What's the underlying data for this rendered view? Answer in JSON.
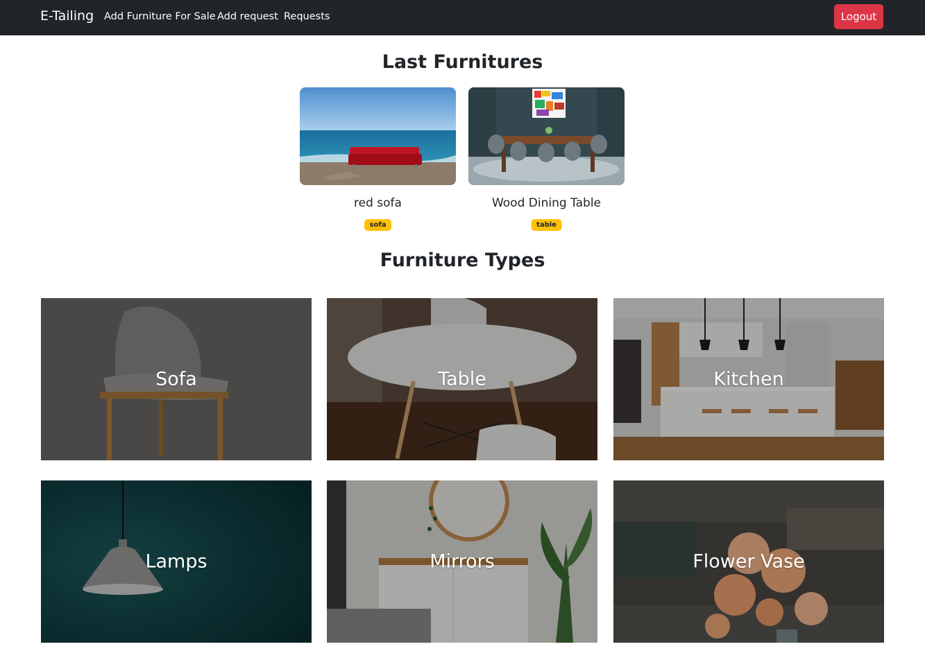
{
  "navbar": {
    "brand": "E-Tailing",
    "links": [
      "Add Furniture For Sale",
      "Add request",
      "Requests"
    ],
    "logout_label": "Logout"
  },
  "last_furnitures": {
    "title": "Last Furnitures",
    "items": [
      {
        "name": "red sofa",
        "badge": "sofa"
      },
      {
        "name": "Wood Dining Table",
        "badge": "table"
      }
    ]
  },
  "furniture_types": {
    "title": "Furniture Types",
    "items": [
      {
        "label": "Sofa"
      },
      {
        "label": "Table"
      },
      {
        "label": "Kitchen"
      },
      {
        "label": "Lamps"
      },
      {
        "label": "Mirrors"
      },
      {
        "label": "Flower Vase"
      }
    ]
  },
  "colors": {
    "navbar_bg": "#212529",
    "logout_bg": "#dc3545",
    "badge_bg": "#ffc107"
  }
}
